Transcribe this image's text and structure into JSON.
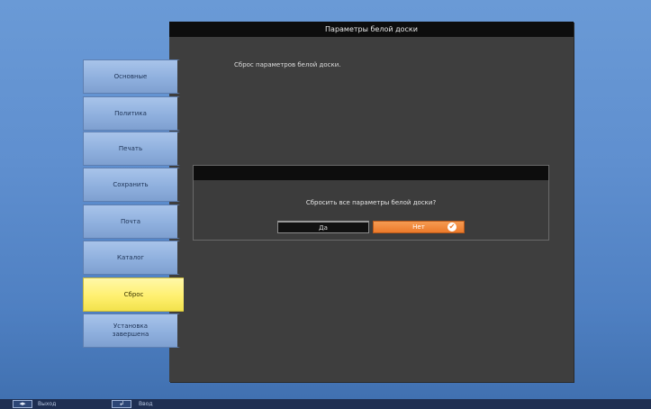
{
  "window": {
    "title": "Параметры белой доски",
    "description": "Сброс параметров белой доски."
  },
  "sidebar": {
    "items": [
      {
        "label": "Основные",
        "active": false
      },
      {
        "label": "Политика",
        "active": false
      },
      {
        "label": "Печать",
        "active": false
      },
      {
        "label": "Сохранить",
        "active": false
      },
      {
        "label": "Почта",
        "active": false
      },
      {
        "label": "Каталог",
        "active": false
      },
      {
        "label": "Сброс",
        "active": true
      },
      {
        "label": "Установка\nзавершена",
        "active": false
      }
    ]
  },
  "dialog": {
    "question": "Сбросить все параметры белой доски?",
    "yes_label": "Да",
    "no_label": "Нет",
    "selected": "no",
    "selected_icon": "check-circle-icon"
  },
  "help_bar": {
    "exit_key": "◂▸",
    "exit_label": "Выход",
    "enter_key": "↲",
    "enter_label": "Ввод"
  },
  "colors": {
    "background": "#5f8fcf",
    "panel": "#3e3e3e",
    "titlebar": "#0d0d0d",
    "tab": "#8fb0de",
    "tab_active": "#fff070",
    "accent_button": "#ec7a2a"
  }
}
